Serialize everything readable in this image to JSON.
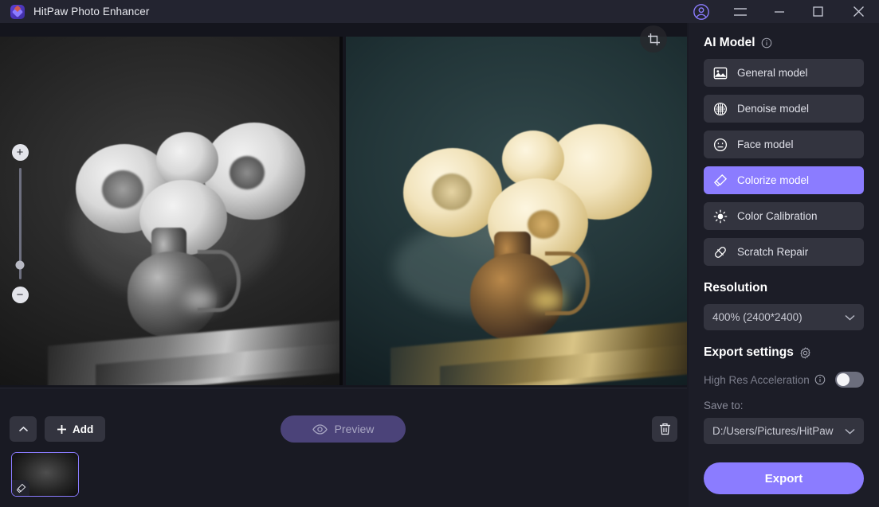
{
  "titlebar": {
    "app_title": "HitPaw Photo Enhancer",
    "logo_icon": "hitpaw-logo-icon",
    "account_icon": "user-account-icon",
    "menu_icon": "hamburger-menu-icon",
    "minimize_icon": "minimize-icon",
    "maximize_icon": "maximize-icon",
    "close_icon": "close-icon"
  },
  "canvas": {
    "crop_icon": "crop-icon",
    "zoom_in_label": "+",
    "zoom_out_label": "−",
    "zoom_slider_position": "87%",
    "before_image_alt": "black and white photo of roses in a vase on a book",
    "after_image_alt": "colorized photo of cream roses in a brass vase on a book"
  },
  "bottombar": {
    "collapse_icon": "chevron-up-icon",
    "add_label": "Add",
    "add_icon": "plus-icon",
    "preview_label": "Preview",
    "preview_icon": "eye-icon",
    "delete_icon": "trash-icon",
    "thumbnail_badge_icon": "colorize-badge-icon"
  },
  "panel": {
    "ai_model": {
      "title": "AI Model",
      "info_icon": "info-icon",
      "items": [
        {
          "label": "General model",
          "icon": "picture-icon",
          "active": false
        },
        {
          "label": "Denoise model",
          "icon": "denoise-grid-icon",
          "active": false
        },
        {
          "label": "Face model",
          "icon": "face-icon",
          "active": false
        },
        {
          "label": "Colorize model",
          "icon": "colorize-brush-icon",
          "active": true
        },
        {
          "label": "Color Calibration",
          "icon": "brightness-sun-icon",
          "active": false
        },
        {
          "label": "Scratch Repair",
          "icon": "bandage-icon",
          "active": false
        }
      ]
    },
    "resolution": {
      "title": "Resolution",
      "value": "400% (2400*2400)",
      "caret_icon": "chevron-down-icon"
    },
    "export_settings": {
      "title": "Export settings",
      "gear_icon": "gear-icon",
      "high_res_label": "High Res Acceleration",
      "high_res_info_icon": "info-icon",
      "high_res_enabled": "off",
      "save_to_label": "Save to:",
      "save_to_value": "D:/Users/Pictures/HitPaw",
      "save_to_caret_icon": "chevron-down-icon",
      "export_label": "Export"
    }
  },
  "colors": {
    "accent": "#8b7cff",
    "panel_bg": "#1c1d27",
    "titlebar_bg": "#232430",
    "item_bg": "#33343f",
    "canvas_bg": "#14151d"
  }
}
